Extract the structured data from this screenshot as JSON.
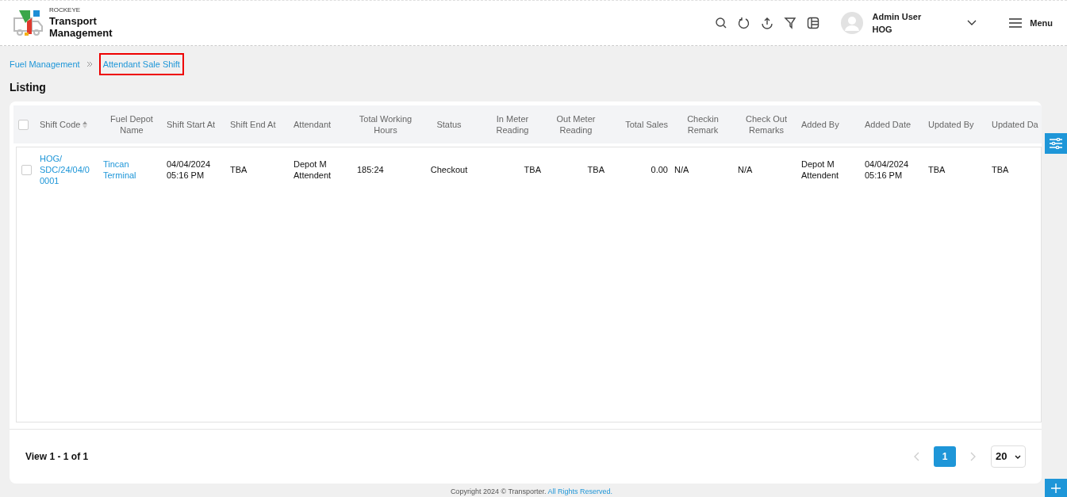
{
  "brand": {
    "company": "ROCKEYE",
    "product": "Transport Management"
  },
  "user": {
    "name": "Admin User",
    "org": "HOG"
  },
  "menu_label": "Menu",
  "breadcrumb": [
    {
      "label": "Fuel Management",
      "current": false
    },
    {
      "label": "Attendant Sale Shift",
      "current": true
    }
  ],
  "page_title": "Listing",
  "table": {
    "select_all_checked": false,
    "columns": [
      {
        "label": "Shift Code",
        "sortable": true
      },
      {
        "label": "Fuel Depot Name",
        "sortable": false
      },
      {
        "label": "Shift Start At",
        "sortable": false
      },
      {
        "label": "Shift End At",
        "sortable": false
      },
      {
        "label": "Attendant",
        "sortable": false
      },
      {
        "label": "Total Working Hours",
        "sortable": false
      },
      {
        "label": "Status",
        "sortable": false
      },
      {
        "label": "In Meter Reading",
        "sortable": false
      },
      {
        "label": "Out Meter Reading",
        "sortable": false
      },
      {
        "label": "Total Sales",
        "sortable": false
      },
      {
        "label": "Checkin Remark",
        "sortable": false
      },
      {
        "label": "Check Out Remarks",
        "sortable": false
      },
      {
        "label": "Added By",
        "sortable": false
      },
      {
        "label": "Added Date",
        "sortable": false
      },
      {
        "label": "Updated By",
        "sortable": false
      },
      {
        "label": "Updated Da",
        "sortable": false
      }
    ],
    "rows": [
      {
        "checked": false,
        "cells": [
          {
            "kind": "link",
            "text": "HOG/ SDC/24/04/0 0001"
          },
          {
            "kind": "link",
            "text": "Tincan Terminal"
          },
          {
            "kind": "text",
            "text": "04/04/2024 05:16 PM"
          },
          {
            "kind": "text",
            "text": "TBA"
          },
          {
            "kind": "text",
            "text": "Depot M Attendent"
          },
          {
            "kind": "text",
            "text": "185:24"
          },
          {
            "kind": "text",
            "text": "Checkout"
          },
          {
            "kind": "text",
            "text": "TBA"
          },
          {
            "kind": "text",
            "text": "TBA"
          },
          {
            "kind": "text",
            "text": "0.00"
          },
          {
            "kind": "text",
            "text": "N/A"
          },
          {
            "kind": "text",
            "text": "N/A"
          },
          {
            "kind": "text",
            "text": "Depot M Attendent"
          },
          {
            "kind": "text",
            "text": "04/04/2024 05:16 PM"
          },
          {
            "kind": "text",
            "text": "TBA"
          },
          {
            "kind": "text",
            "text": "TBA"
          }
        ]
      }
    ]
  },
  "pagination": {
    "summary": "View 1 - 1 of 1",
    "pages": [
      {
        "label": "1",
        "selected": true
      }
    ],
    "page_size": "20"
  },
  "footer": {
    "text": "Copyright 2024 © Transporter.",
    "link": "All Rights Reserved."
  }
}
